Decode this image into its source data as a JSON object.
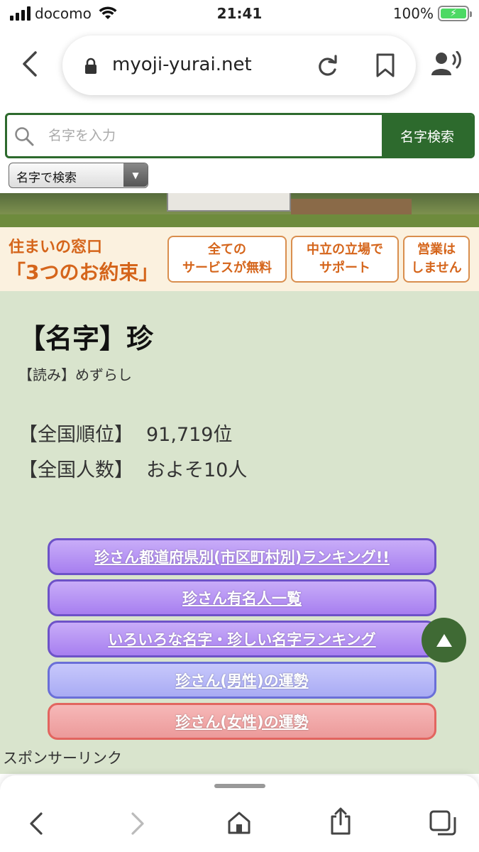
{
  "status": {
    "carrier": "docomo",
    "time": "21:41",
    "battery": "100%"
  },
  "browser": {
    "url": "myoji-yurai.net"
  },
  "search": {
    "placeholder": "名字を入力",
    "button_label": "名字検索",
    "mode_label": "名字で検索"
  },
  "ad": {
    "headline": "住まいの窓口",
    "promise": "「3つのお約束」",
    "box1_line1": "全ての",
    "box1_line2": "サービスが無料",
    "box2_line1": "中立の立場で",
    "box2_line2": "サポート",
    "box3_line1": "営業は",
    "box3_line2": "しません"
  },
  "surname": {
    "title": "【名字】珍",
    "reading": "【読み】めずらし",
    "rank_label": "【全国順位】",
    "rank_value": "91,719位",
    "count_label": "【全国人数】",
    "count_value": "およそ10人"
  },
  "links": [
    {
      "label": "珍さん都道府県別(市区町村別)ランキング!!"
    },
    {
      "label": "珍さん有名人一覧"
    },
    {
      "label": "いろいろな名字・珍しい名字ランキング"
    },
    {
      "label": "珍さん(男性)の運勢"
    },
    {
      "label": "珍さん(女性)の運勢"
    }
  ],
  "sponsor_label": "スポンサーリンク",
  "colors": {
    "page_bg": "#d9e4cd",
    "search_green": "#2d6a2d",
    "link_purple": "#a77ff0",
    "link_blue": "#a9abf4",
    "link_pink": "#ec9a9a"
  }
}
